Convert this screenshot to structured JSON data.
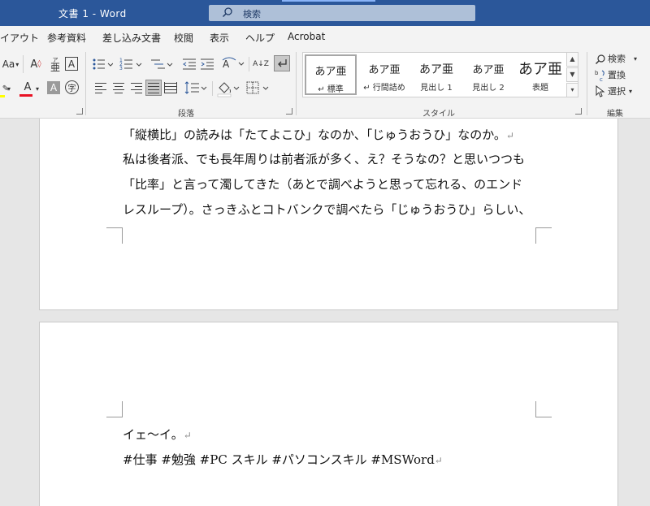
{
  "window": {
    "title": "文書 1  -  Word",
    "search_placeholder": "検索"
  },
  "menu": {
    "tabs": [
      "イアウト",
      "参考資料",
      "差し込み文書",
      "校閲",
      "表示",
      "ヘルプ",
      "Acrobat"
    ]
  },
  "ribbon": {
    "font": {
      "size_grow_label": "Aa",
      "phonetic_label": "亜",
      "phonetic_small": "ア",
      "border_char_label": "A",
      "font_color_label": "A",
      "char_shading_label": "A",
      "enclose_label": "字"
    },
    "paragraph": {
      "group_label": "段落",
      "sort_label": "A↓Z"
    },
    "styles": {
      "group_label": "スタイル",
      "items": [
        {
          "sample": "あア亜",
          "name": "↵ 標準"
        },
        {
          "sample": "あア亜",
          "name": "↵ 行間詰め"
        },
        {
          "sample": "あア亜",
          "name": "見出し 1"
        },
        {
          "sample": "あア亜",
          "name": "見出し 2"
        },
        {
          "sample": "あア亜",
          "name": "表題"
        }
      ]
    },
    "editing": {
      "group_label": "編集",
      "find_label": "検索",
      "replace_label": "置換",
      "select_label": "選択"
    }
  },
  "document": {
    "page1_lines": [
      "「縦横比」の読みは「たてよこひ」なのか、「じゅうおうひ」なのか。",
      "私は後者派、でも長年周りは前者派が多く、え？そうなの？と思いつつも",
      "「比率」と言って濁してきた（あとで調べようと思って忘れる、のエンド",
      "レスループ）。さっきふとコトバンクで調べたら「じゅうおうひ」らしい、"
    ],
    "page2_lines": [
      "イェ〜イ。",
      "#仕事 #勉強 #PC スキル #パソコンスキル #MSWord"
    ],
    "paragraph_mark": "↵"
  },
  "colors": {
    "titlebar": "#2b579a",
    "font_color_underline": "#e81123",
    "highlight": "#ffff00"
  }
}
